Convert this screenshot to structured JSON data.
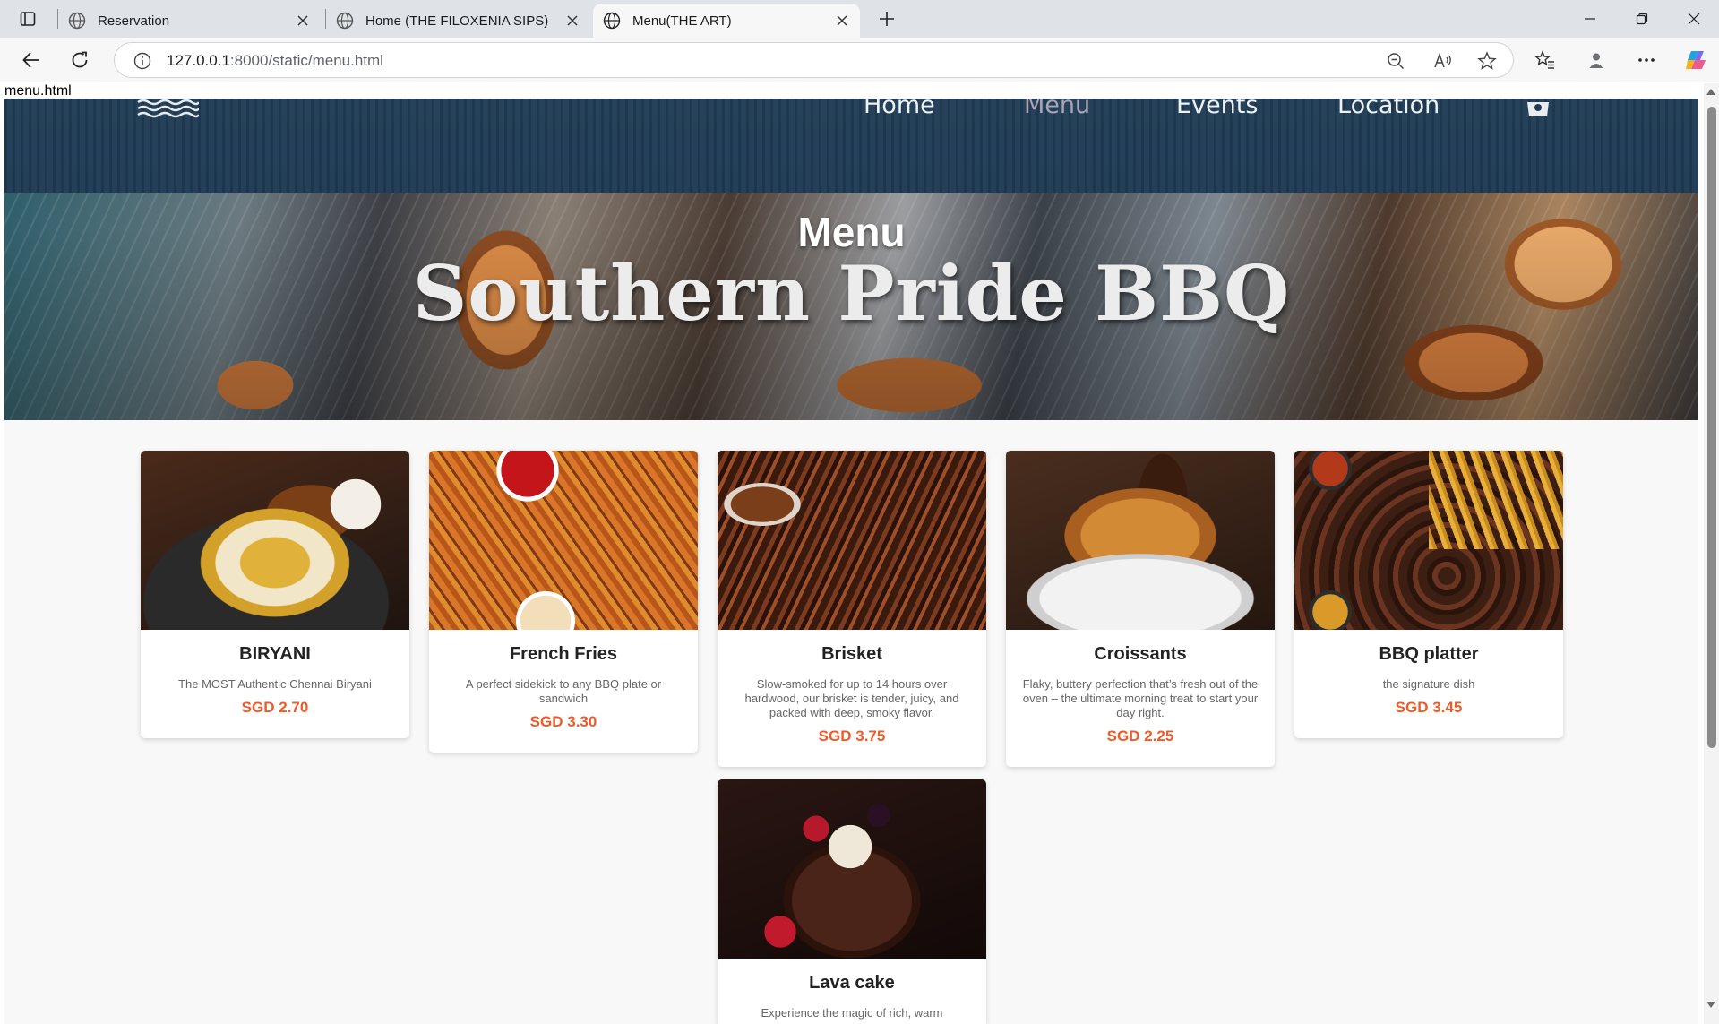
{
  "browser": {
    "tabs": [
      {
        "title": "Reservation",
        "active": false
      },
      {
        "title": "Home (THE FILOXENIA SIPS)",
        "active": false
      },
      {
        "title": "Menu(THE ART)",
        "active": true
      }
    ],
    "url_host": "127.0.0.1",
    "url_rest": ":8000/static/menu.html",
    "accent": "#1a73e8"
  },
  "page": {
    "label": "menu.html",
    "nav": {
      "home": "Home",
      "menu": "Menu",
      "events": "Events",
      "location": "Location"
    },
    "hero": {
      "title": "Menu",
      "subtitle": "Southern Pride BBQ"
    },
    "items": [
      {
        "name": "BIRYANI",
        "desc": "The MOST Authentic Chennai Biryani",
        "price": "SGD 2.70"
      },
      {
        "name": "French Fries",
        "desc": "A perfect sidekick to any BBQ plate or sandwich",
        "price": "SGD 3.30"
      },
      {
        "name": "Brisket",
        "desc": "Slow-smoked for up to 14 hours over hardwood, our brisket is tender, juicy, and packed with deep, smoky flavor.",
        "price": "SGD 3.75"
      },
      {
        "name": "Croissants",
        "desc": "Flaky, buttery perfection that’s fresh out of the oven – the ultimate morning treat to start your day right.",
        "price": "SGD 2.25"
      },
      {
        "name": "BBQ platter",
        "desc": "the signature dish",
        "price": "SGD 3.45"
      },
      {
        "name": "Lava cake",
        "desc": "Experience the magic of rich, warm",
        "price": ""
      }
    ],
    "price_color": "#f05a28"
  }
}
